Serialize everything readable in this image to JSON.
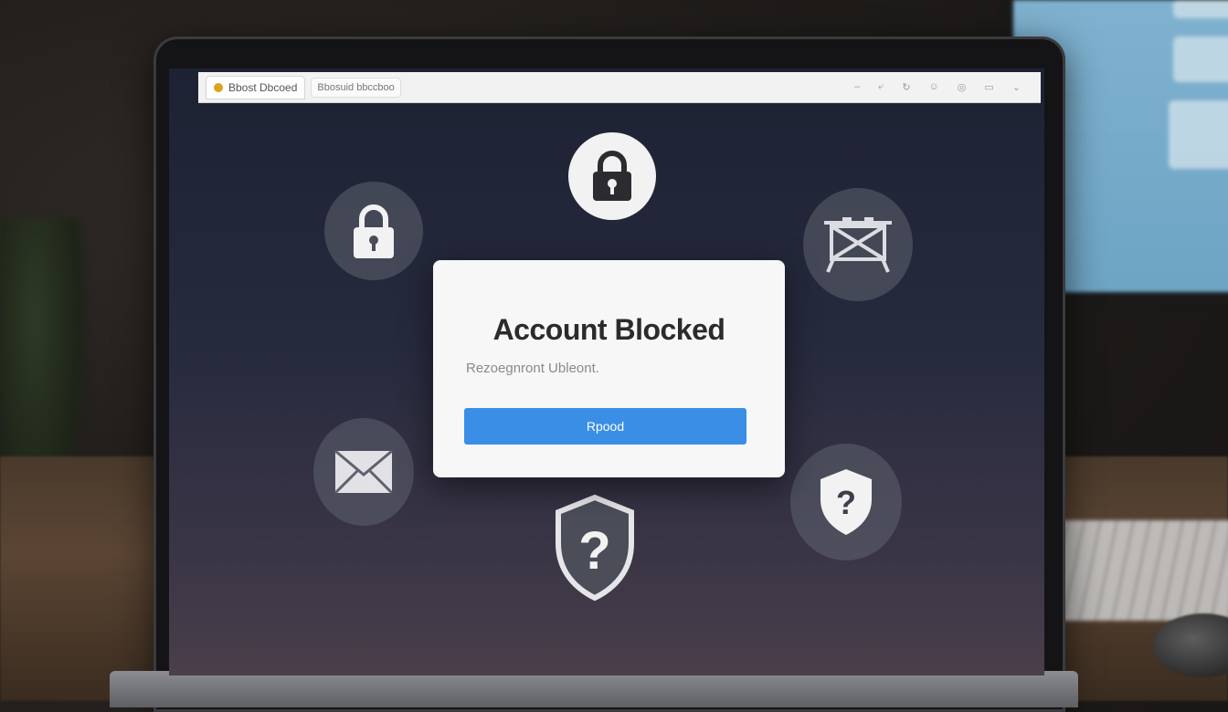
{
  "browser": {
    "tab_title": "Bbost Dbcoed",
    "address": "Bbosuid bbccboo",
    "toolbar_icons": [
      "minimize-icon",
      "back-icon",
      "refresh-icon",
      "profile-icon",
      "settings-icon",
      "screen-icon",
      "chevron-down-icon"
    ]
  },
  "modal": {
    "title": "Account Blocked",
    "subtitle": "Rezoegnront Ubleont.",
    "button_label": "Rpood",
    "button_color": "#3a8ee6"
  },
  "icons": [
    "lock-icon",
    "padlock-icon",
    "blocked-network-icon",
    "mail-icon",
    "shield-question-icon",
    "shield-question-icon"
  ]
}
